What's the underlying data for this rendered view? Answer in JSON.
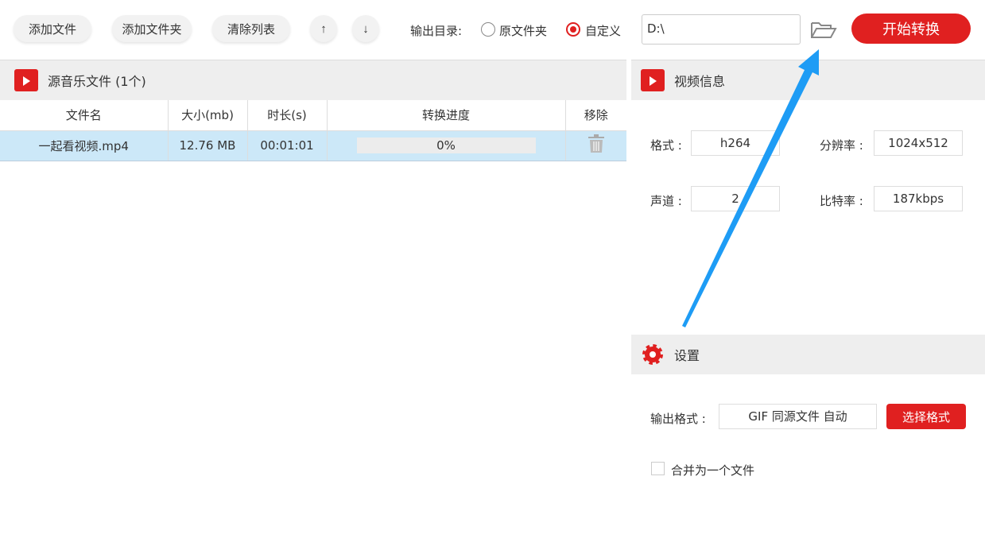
{
  "toolbar": {
    "add_file": "添加文件",
    "add_folder": "添加文件夹",
    "clear_list": "清除列表",
    "up": "↑",
    "down": "↓",
    "output_dir_label": "输出目录:",
    "opt_original": "原文件夹",
    "opt_custom": "自定义",
    "path": "D:\\",
    "start": "开始转换"
  },
  "files": {
    "title": "源音乐文件 (1个)",
    "columns": [
      "文件名",
      "大小(mb)",
      "时长(s)",
      "转换进度",
      "移除"
    ],
    "rows": [
      {
        "name": "一起看视频.mp4",
        "size": "12.76 MB",
        "duration": "00:01:01",
        "progress": "0%",
        "progress_value": 0
      }
    ]
  },
  "video_info": {
    "title": "视频信息",
    "format_label": "格式 :",
    "format": "h264",
    "resolution_label": "分辨率 :",
    "resolution": "1024x512",
    "channels_label": "声道 :",
    "channels": "2",
    "bitrate_label": "比特率 :",
    "bitrate": "187kbps"
  },
  "settings": {
    "title": "设置",
    "output_format_label": "输出格式 :",
    "output_format": "GIF 同源文件 自动",
    "choose_format": "选择格式",
    "merge_label": "合并为一个文件"
  },
  "colors": {
    "accent": "#e02020",
    "annotation": "#1e9cf5",
    "selected_row": "#cce8f8"
  }
}
